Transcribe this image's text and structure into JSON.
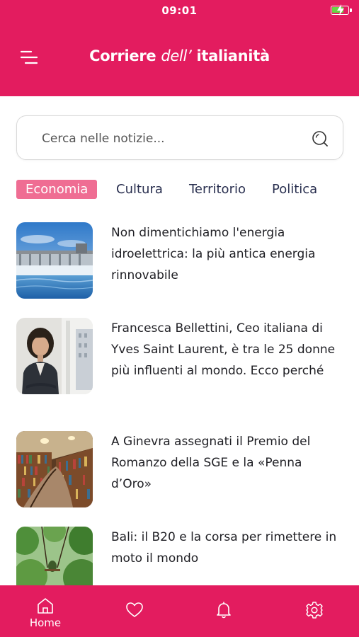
{
  "status": {
    "time": "09:01",
    "battery_level": 0.75,
    "charging": true
  },
  "header": {
    "title_start": "Corriere ",
    "title_middle": "dell’",
    "title_end": " italianità",
    "background_color": "#e31c5f",
    "menu_icon": "menu-icon"
  },
  "search": {
    "placeholder": "Cerca nelle notizie...",
    "value": "",
    "icon": "search-icon"
  },
  "tabs": [
    {
      "label": "Economia",
      "active": true
    },
    {
      "label": "Cultura",
      "active": false
    },
    {
      "label": "Territorio",
      "active": false
    },
    {
      "label": "Politica",
      "active": false
    }
  ],
  "articles": [
    {
      "title": "Non dimentichiamo l'energia idroelettrica: la più antica energia rinnovabile",
      "image": "dam-image"
    },
    {
      "title": "Francesca Bellettini, Ceo italiana di Yves Saint Laurent, è tra le 25 donne più influenti al mondo. Ecco perché",
      "image": "portrait-image"
    },
    {
      "title": "A Ginevra assegnati il Premio del Romanzo della SGE e la «Penna d’Oro»",
      "image": "library-image"
    },
    {
      "title": "Bali: il B20 e la corsa per rimettere in moto il mondo",
      "image": "jungle-swing-image"
    }
  ],
  "bottom_nav": [
    {
      "label": "Home",
      "icon": "home-icon"
    },
    {
      "label": "",
      "icon": "heart-icon"
    },
    {
      "label": "",
      "icon": "bell-icon"
    },
    {
      "label": "",
      "icon": "gear-icon"
    }
  ],
  "colors": {
    "accent": "#e31c5f",
    "active_tab": "#ef6d93",
    "tab_text": "#2a3050",
    "battery": "#67d645"
  }
}
